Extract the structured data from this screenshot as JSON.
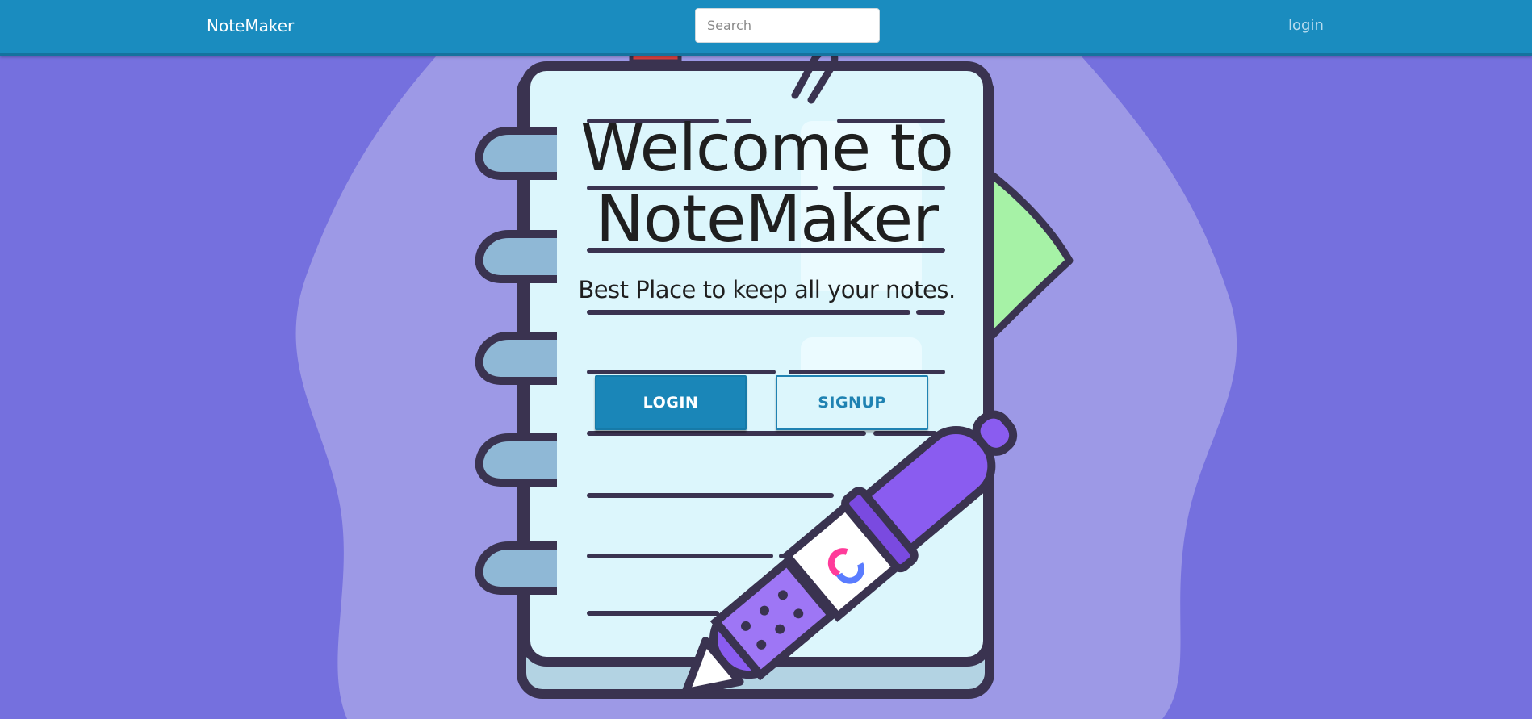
{
  "navbar": {
    "brand": "NoteMaker",
    "search_placeholder": "Search",
    "login_link": "login"
  },
  "hero": {
    "title": "Welcome to NoteMaker",
    "subtitle": "Best Place to keep all your notes.",
    "login_button": "LOGIN",
    "signup_button": "SIGNUP"
  },
  "illustration": {
    "subject": "notebook-with-pen",
    "colors": {
      "background": "#7570de",
      "blob": "#9d99e6",
      "page": "#dcf6fc",
      "outline": "#3a3350",
      "pen": "#8a5cf0",
      "leaf": "#a6f2a6"
    }
  },
  "theme": {
    "primary": "#1a8cbf"
  }
}
